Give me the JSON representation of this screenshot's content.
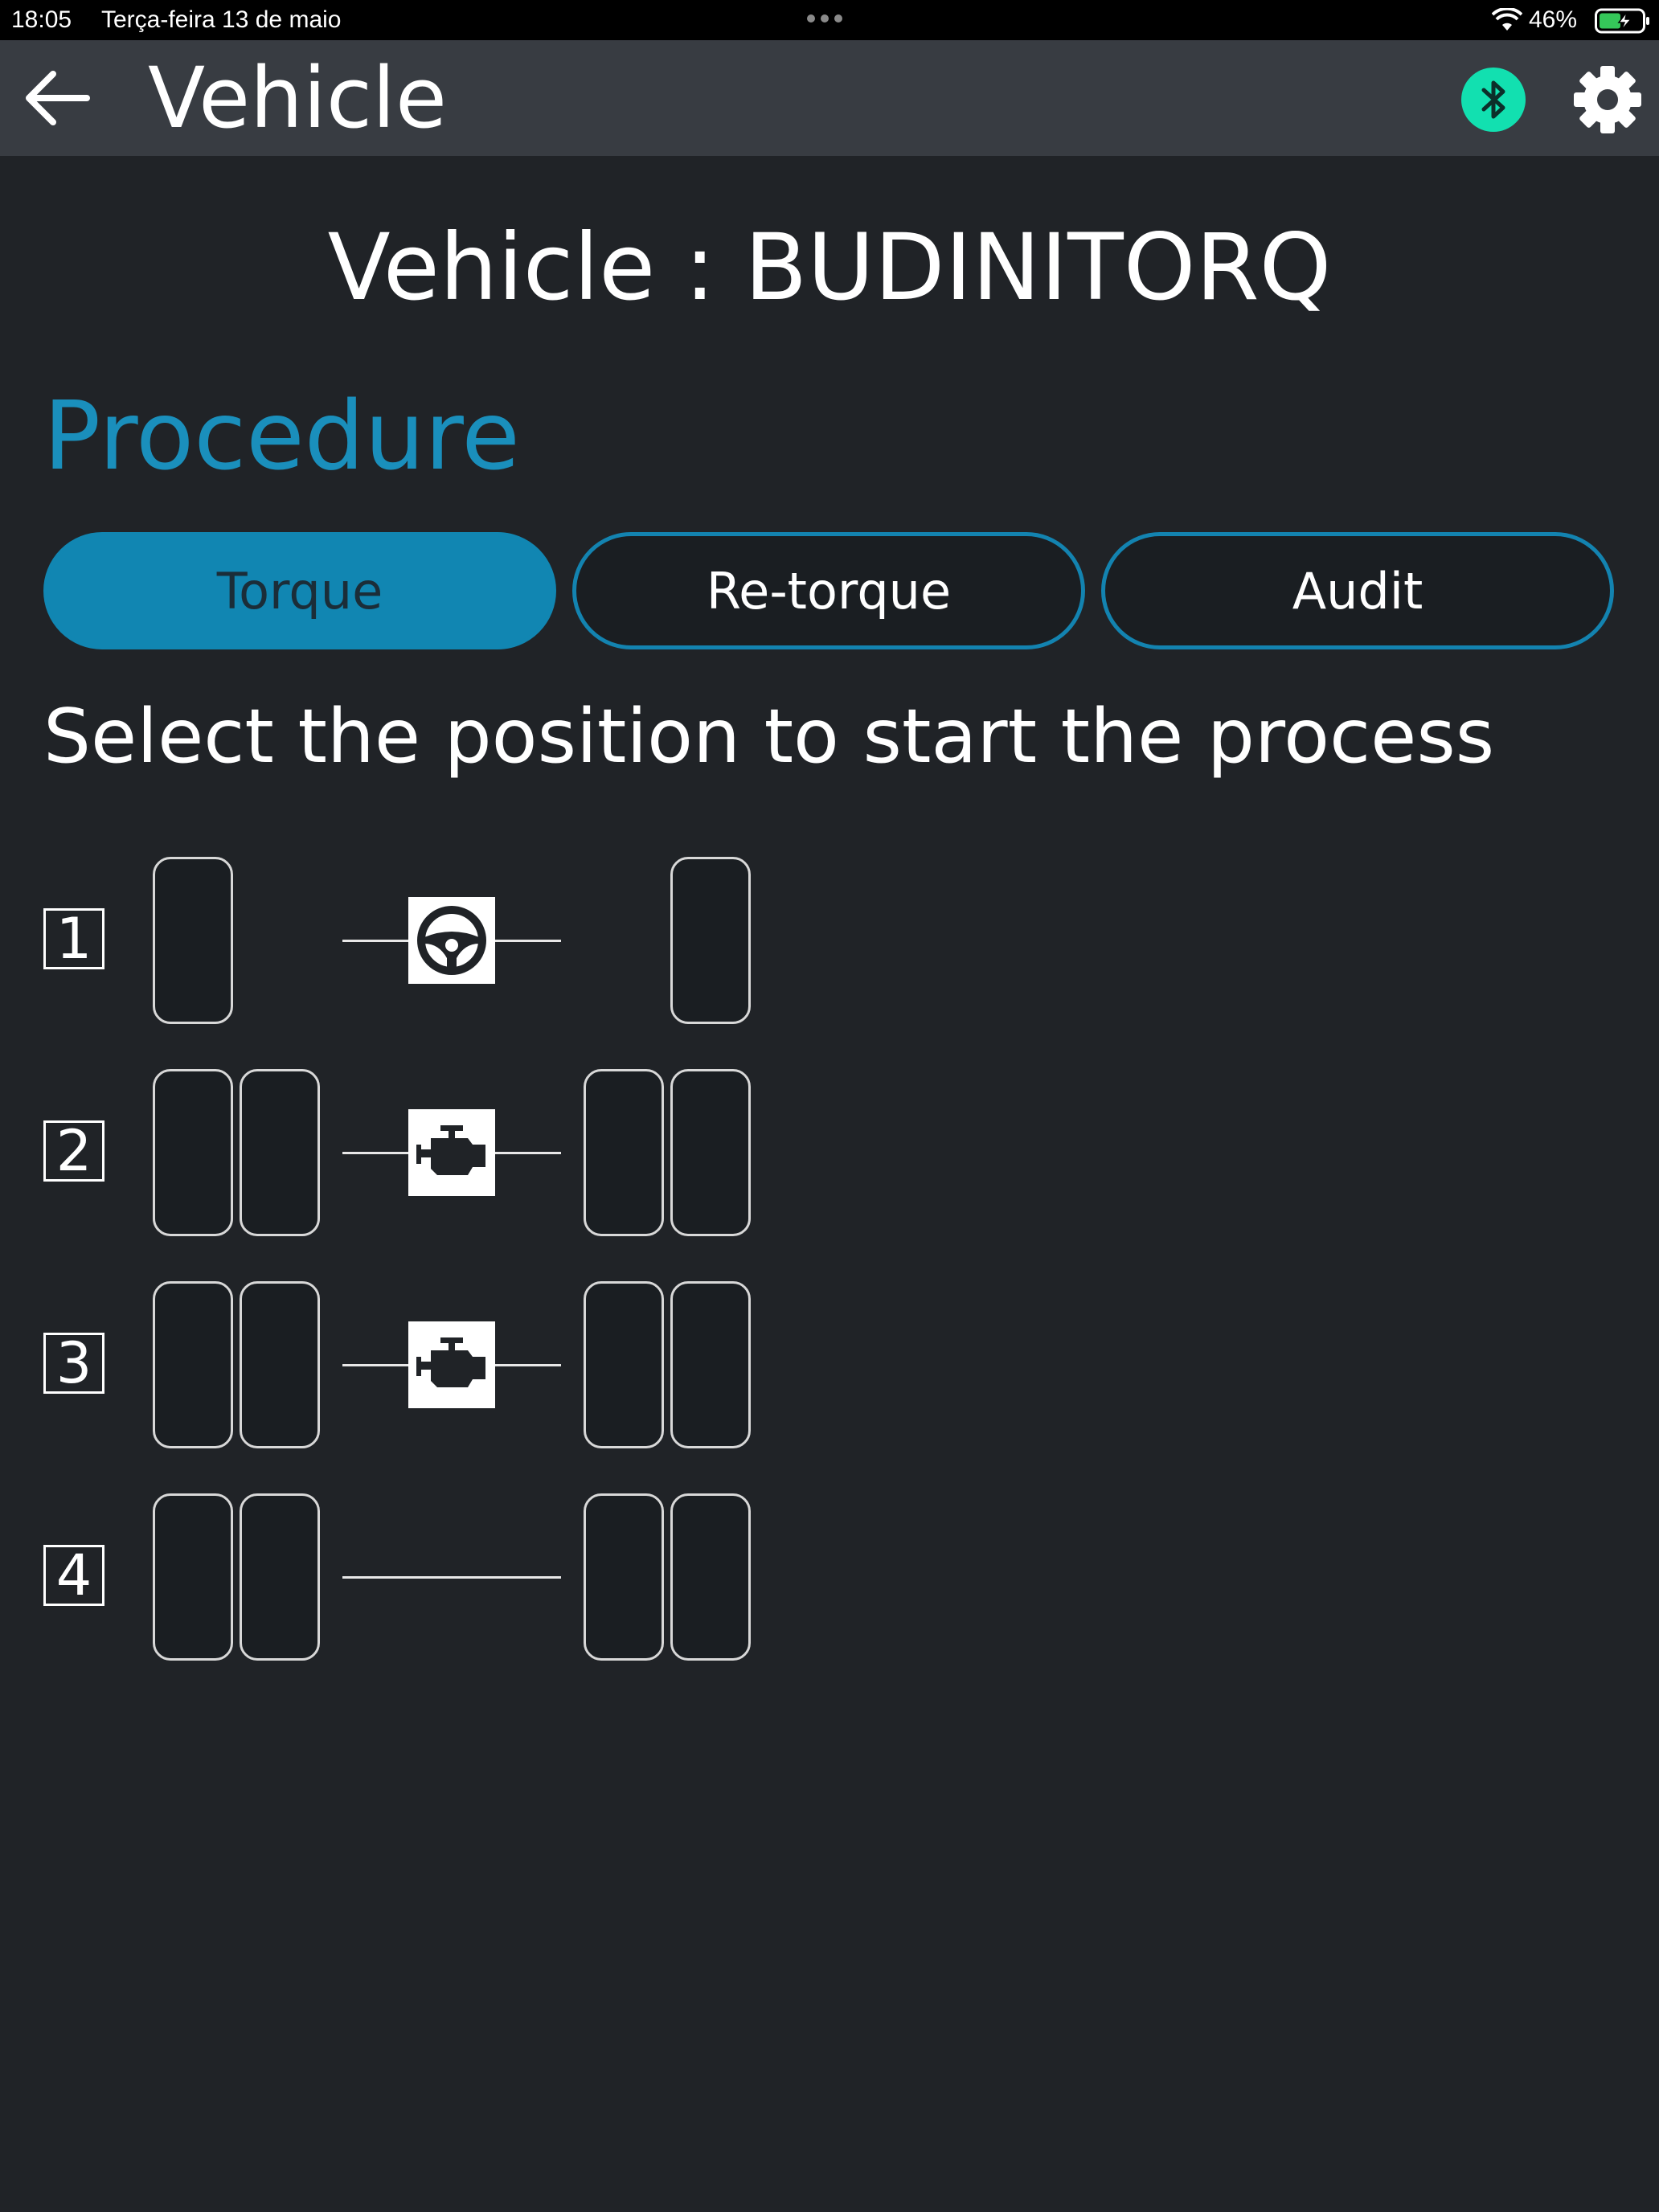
{
  "status_bar": {
    "time": "18:05",
    "date": "Terça-feira 13 de maio",
    "battery_percent": "46%",
    "battery_color": "#35c759"
  },
  "app_bar": {
    "title": "Vehicle",
    "back_icon": "arrow-left-icon",
    "bluetooth_icon": "bluetooth-icon",
    "bluetooth_color": "#12e0b0",
    "settings_icon": "gear-icon"
  },
  "vehicle": {
    "label": "Vehicle : BUDINITORQ"
  },
  "procedure": {
    "title": "Procedure",
    "accent_color": "#1a8fbc",
    "tabs": [
      {
        "label": "Torque",
        "active": true
      },
      {
        "label": "Re-torque",
        "active": false
      },
      {
        "label": "Audit",
        "active": false
      }
    ]
  },
  "instruction": "Select the position to start the process",
  "axles": [
    {
      "number": "1",
      "tires_per_side": 1,
      "icon": "steering-wheel-icon"
    },
    {
      "number": "2",
      "tires_per_side": 2,
      "icon": "engine-icon"
    },
    {
      "number": "3",
      "tires_per_side": 2,
      "icon": "engine-icon"
    },
    {
      "number": "4",
      "tires_per_side": 2,
      "icon": null
    }
  ]
}
